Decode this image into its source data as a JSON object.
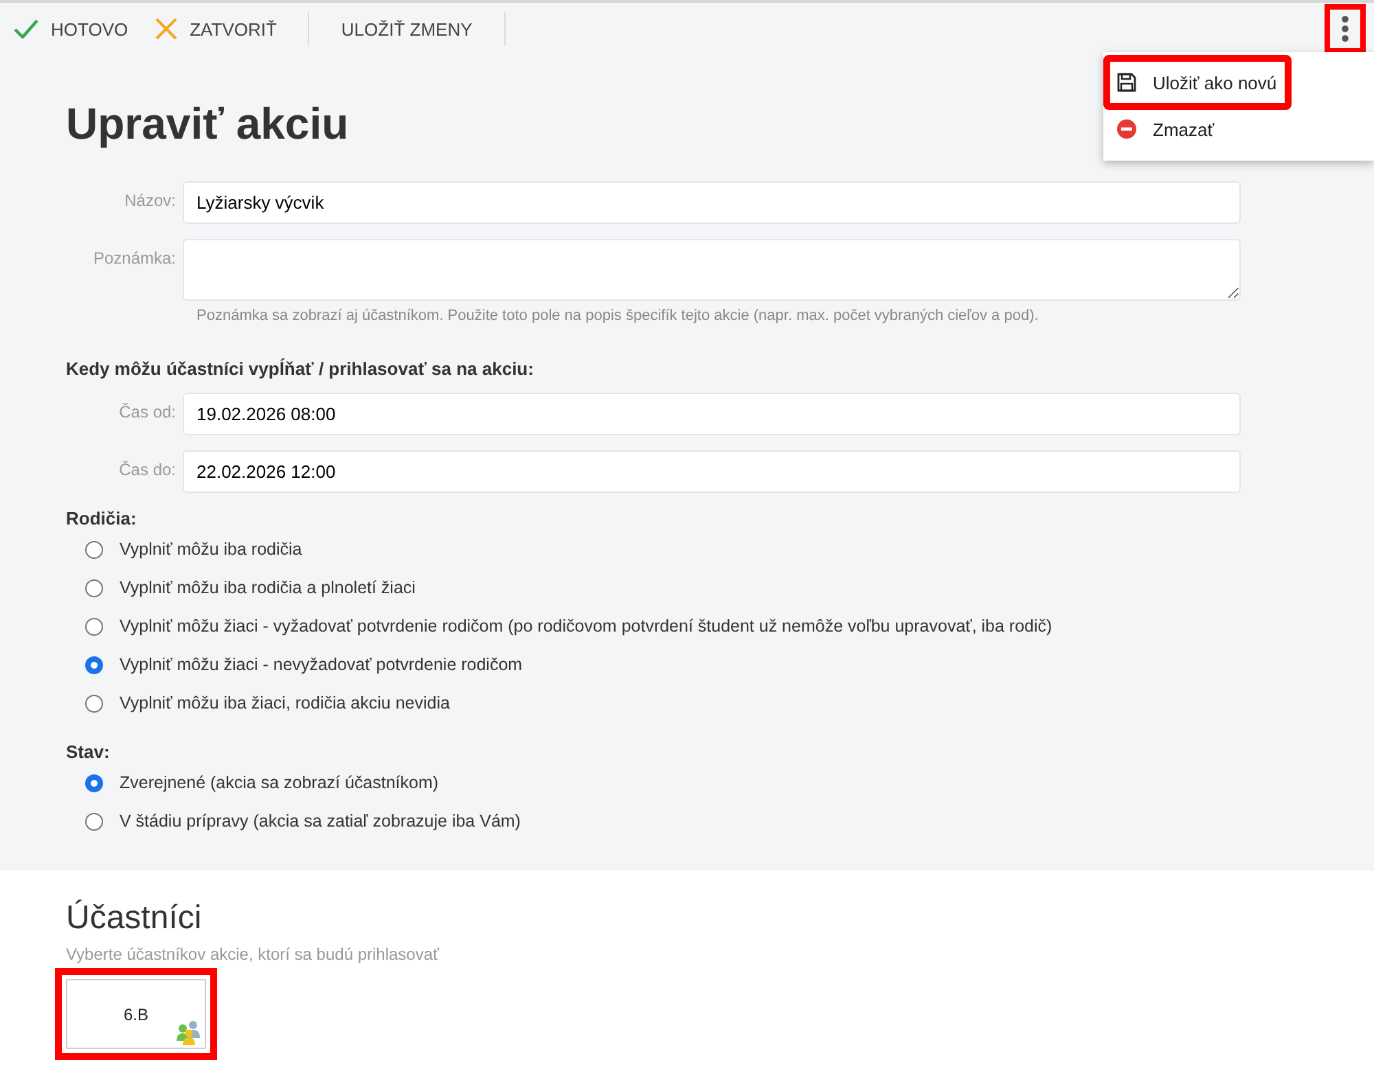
{
  "toolbar": {
    "buttons": [
      {
        "kind": "done",
        "label": "HOTOVO"
      },
      {
        "kind": "close",
        "label": "ZATVORIŤ"
      },
      {
        "kind": "save",
        "label": "ULOŽIŤ ZMENY"
      }
    ],
    "more_button": {
      "highlighted": true
    }
  },
  "menu": {
    "items": [
      {
        "kind": "save-as-new",
        "label": "Uložiť ako novú",
        "highlighted": true
      },
      {
        "kind": "delete",
        "label": "Zmazať",
        "highlighted": false
      }
    ]
  },
  "title": "Upraviť akciu",
  "fields": [
    {
      "kind": "text",
      "label": "Názov:",
      "value": "Lyžiarsky výcvik"
    },
    {
      "kind": "textarea",
      "label": "Poznámka:",
      "hint": "Poznámka sa zobrazí aj účastníkom. Použite toto pole na popis špecifík tejto akcie (napr. max. počet vybraných cieľov a pod)."
    }
  ],
  "schedule": {
    "heading": "Kedy môžu účastníci vypĺňať / prihlasovať sa na akciu:",
    "fields": [
      {
        "kind": "text",
        "label": "Čas od:",
        "value": "19.02.2026 08:00"
      },
      {
        "kind": "text",
        "label": "Čas do:",
        "value": "22.02.2026 12:00"
      }
    ]
  },
  "parents": {
    "heading": "Rodičia:",
    "options": [
      {
        "label": "Vyplniť môžu iba rodičia",
        "selected": false
      },
      {
        "label": "Vyplniť môžu iba rodičia a plnoletí žiaci",
        "selected": false
      },
      {
        "label": "Vyplniť môžu žiaci - vyžadovať potvrdenie rodičom (po rodičovom potvrdení študent už nemôže voľbu upravovať, iba rodič)",
        "selected": false
      },
      {
        "label": "Vyplniť môžu žiaci - nevyžadovať potvrdenie rodičom",
        "selected": true
      },
      {
        "label": "Vyplniť môžu iba žiaci, rodičia akciu nevidia",
        "selected": false
      }
    ]
  },
  "status": {
    "heading": "Stav:",
    "options": [
      {
        "label": "Zverejnené (akcia sa zobrazí účastníkom)",
        "selected": true
      },
      {
        "label": "V štádiu prípravy (akcia sa zatiaľ zobrazuje iba Vám)",
        "selected": false
      }
    ]
  },
  "participants": {
    "title": "Účastníci",
    "subtitle": "Vyberte účastníkov akcie, ktorí sa budú prihlasovať",
    "groups": [
      {
        "label": "6.B",
        "highlighted": true
      }
    ]
  }
}
